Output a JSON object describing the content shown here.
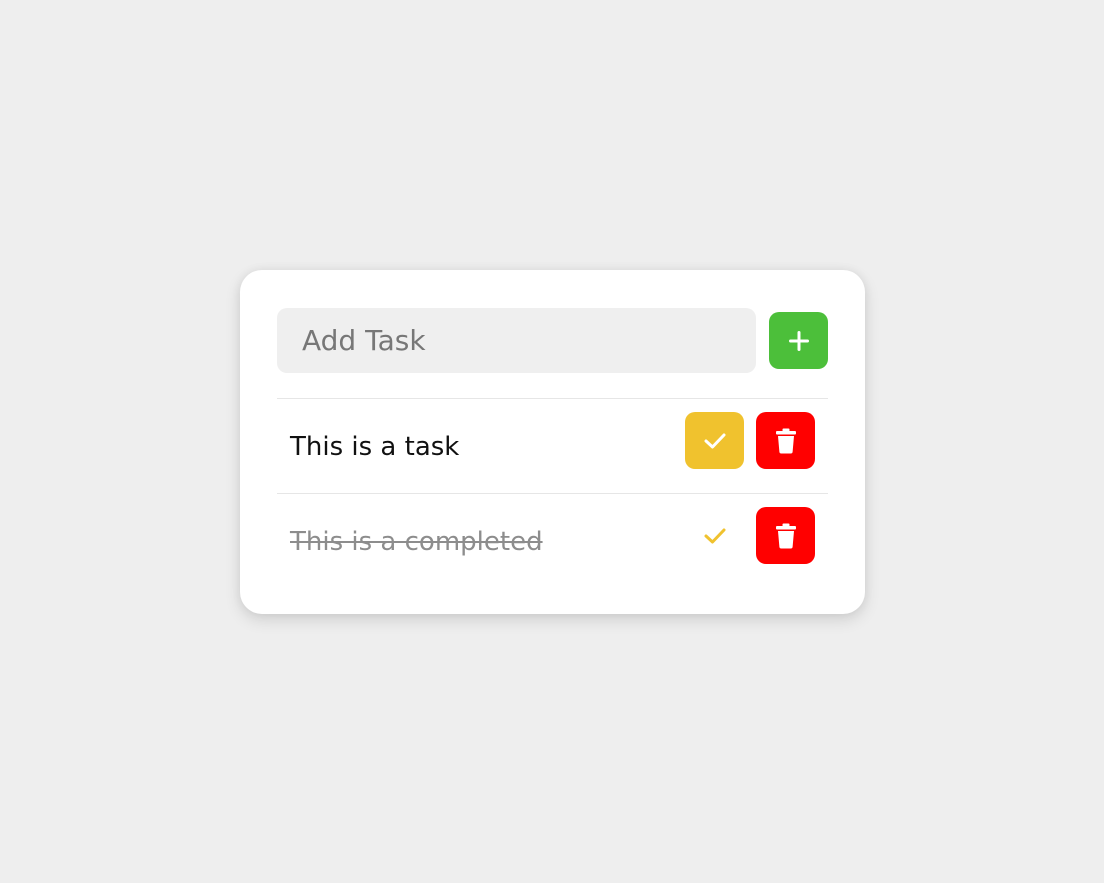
{
  "input": {
    "placeholder": "Add Task",
    "value": ""
  },
  "buttons": {
    "add_icon": "plus-icon",
    "complete_icon": "check-icon",
    "delete_icon": "trash-icon"
  },
  "tasks": [
    {
      "text": "This is a task",
      "completed": false
    },
    {
      "text": "This is a completed",
      "completed": true
    }
  ],
  "colors": {
    "background": "#eeeeee",
    "card": "#ffffff",
    "add_button": "#4cbf3a",
    "complete_button": "#f0c22e",
    "delete_button": "#ff0000",
    "input_background": "#efefef",
    "completed_text": "#8d8d8d"
  }
}
